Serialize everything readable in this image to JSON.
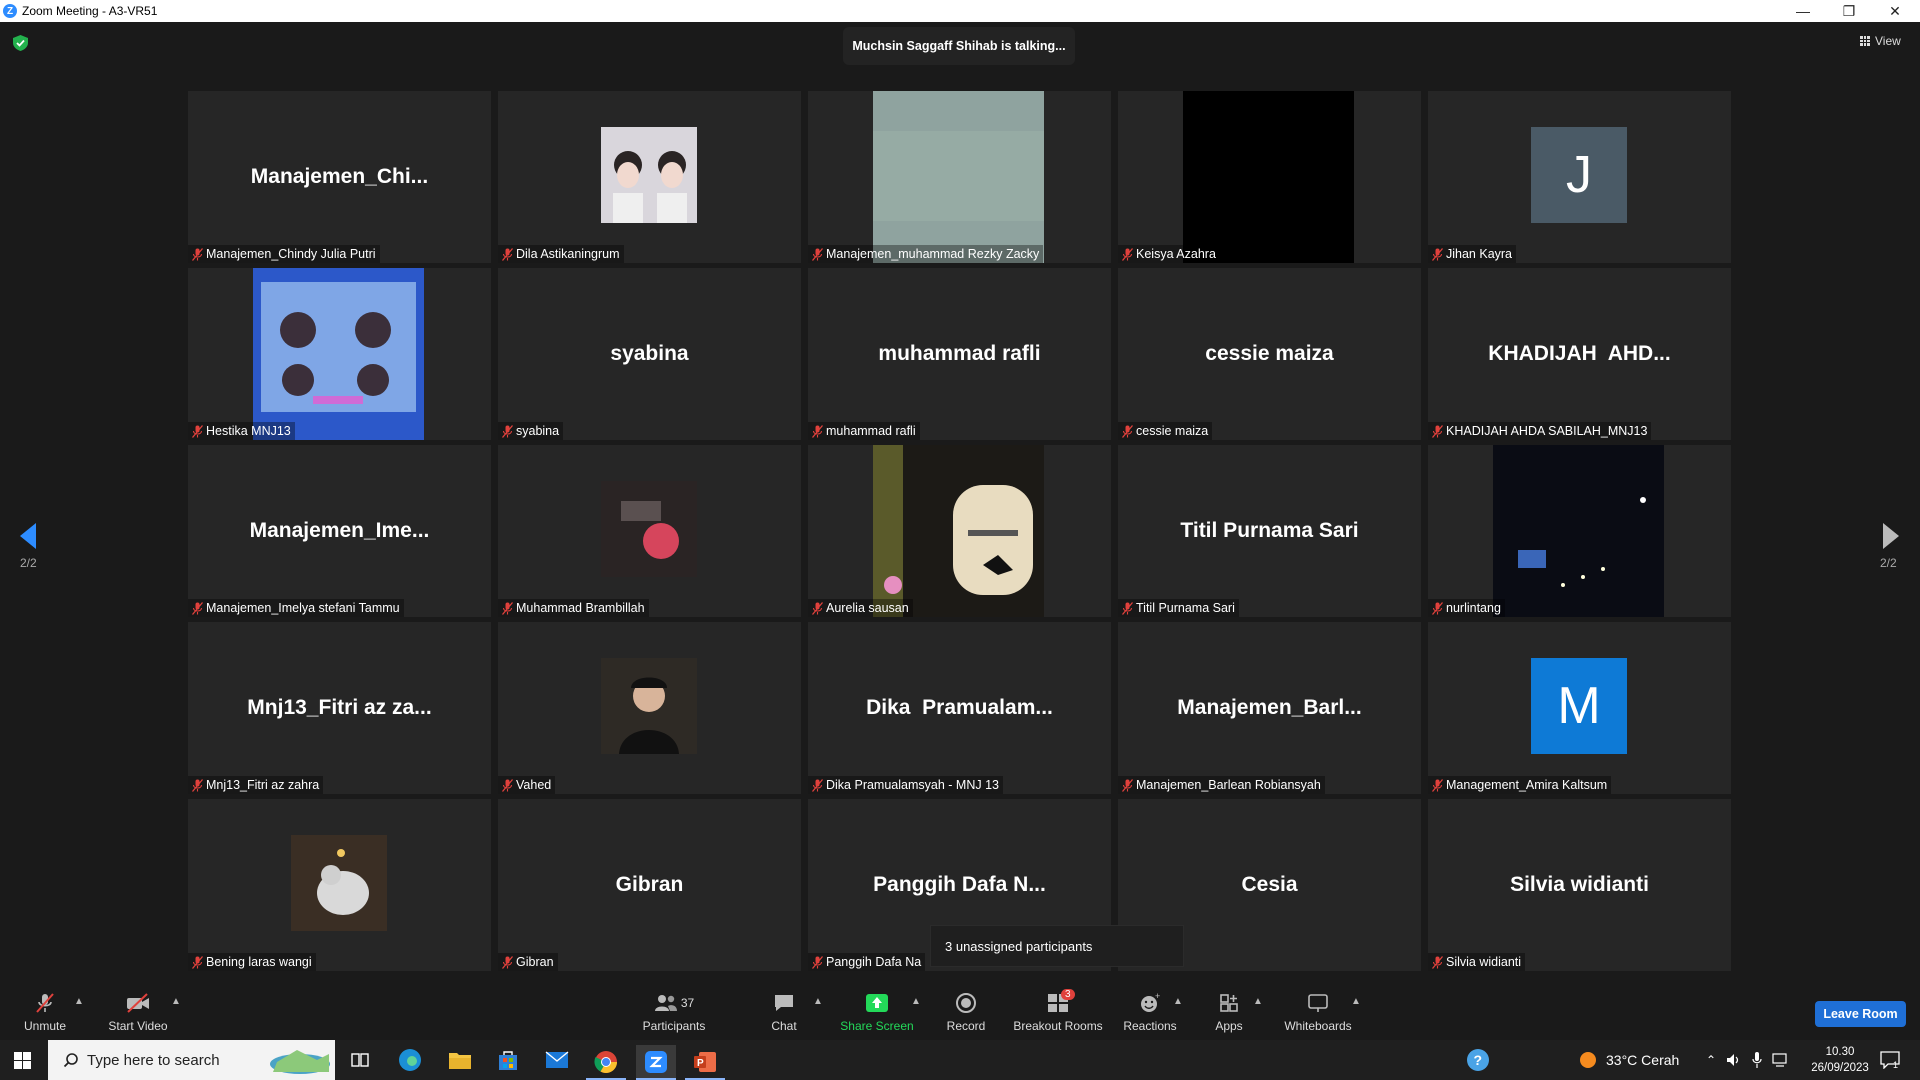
{
  "window": {
    "title": "Zoom Meeting - A3-VR51",
    "logo": "Z"
  },
  "banner": {
    "talking": "Muchsin Saggaff Shihab is talking..."
  },
  "view_label": "View",
  "pager": {
    "left": "2/2",
    "right": "2/2"
  },
  "tiles": [
    {
      "big": "Manajemen_Chi...",
      "label": "Manajemen_Chindy Julia Putri",
      "kind": "name"
    },
    {
      "big": "",
      "label": "Dila Astikaningrum",
      "kind": "photo"
    },
    {
      "big": "",
      "label": "Manajemen_muhammad Rezky Zacky",
      "kind": "camera-gray"
    },
    {
      "big": "",
      "label": "Keisya Azahra",
      "kind": "camera-black"
    },
    {
      "big": "J",
      "label": "Jihan Kayra",
      "kind": "letter",
      "color": "#4a5a66"
    },
    {
      "big": "",
      "label": "Hestika MNJ13",
      "kind": "camera-blue"
    },
    {
      "big": "syabina",
      "label": "syabina",
      "kind": "name"
    },
    {
      "big": "muhammad rafli",
      "label": "muhammad rafli",
      "kind": "name"
    },
    {
      "big": "cessie maiza",
      "label": "cessie maiza",
      "kind": "name"
    },
    {
      "big": "KHADIJAH  AHD...",
      "label": "KHADIJAH AHDA SABILAH_MNJ13",
      "kind": "name"
    },
    {
      "big": "Manajemen_Ime...",
      "label": "Manajemen_Imelya stefani Tammu",
      "kind": "name"
    },
    {
      "big": "",
      "label": "Muhammad Brambillah",
      "kind": "photo-red"
    },
    {
      "big": "",
      "label": "Aurelia sausan",
      "kind": "camera-flowers"
    },
    {
      "big": "Titil Purnama Sari",
      "label": "Titil Purnama Sari",
      "kind": "name"
    },
    {
      "big": "",
      "label": "nurlintang",
      "kind": "camera-night"
    },
    {
      "big": "Mnj13_Fitri az za...",
      "label": "Mnj13_Fitri az zahra",
      "kind": "name"
    },
    {
      "big": "",
      "label": "Vahed",
      "kind": "photo-dark"
    },
    {
      "big": "Dika  Pramualam...",
      "label": "Dika Pramualamsyah - MNJ 13",
      "kind": "name"
    },
    {
      "big": "Manajemen_Barl...",
      "label": "Manajemen_Barlean Robiansyah",
      "kind": "name"
    },
    {
      "big": "M",
      "label": "Management_Amira Kaltsum",
      "kind": "letter",
      "color": "#0e7ad6"
    },
    {
      "big": "",
      "label": "Bening laras wangi",
      "kind": "photo-bird"
    },
    {
      "big": "Gibran",
      "label": "Gibran",
      "kind": "name"
    },
    {
      "big": "Panggih Dafa N...",
      "label": "Panggih Dafa Na",
      "kind": "name"
    },
    {
      "big": "Cesia",
      "label": "",
      "kind": "name"
    },
    {
      "big": "Silvia widianti",
      "label": "Silvia widianti",
      "kind": "name"
    }
  ],
  "popup": {
    "unassigned": "3 unassigned participants"
  },
  "toolbar": {
    "unmute": "Unmute",
    "start_video": "Start Video",
    "participants": "Participants",
    "participants_count": "37",
    "chat": "Chat",
    "share_screen": "Share Screen",
    "record": "Record",
    "breakout_rooms": "Breakout Rooms",
    "breakout_badge": "3",
    "reactions": "Reactions",
    "apps": "Apps",
    "whiteboards": "Whiteboards",
    "leave": "Leave Room"
  },
  "taskbar": {
    "search_placeholder": "Type here to search",
    "weather": "33°C  Cerah",
    "time": "10.30",
    "date": "26/09/2023",
    "notification_count": "1"
  },
  "colors": {
    "share_green": "#23d959",
    "accent_blue": "#1f6fd6",
    "muted_red": "#e0413c"
  }
}
